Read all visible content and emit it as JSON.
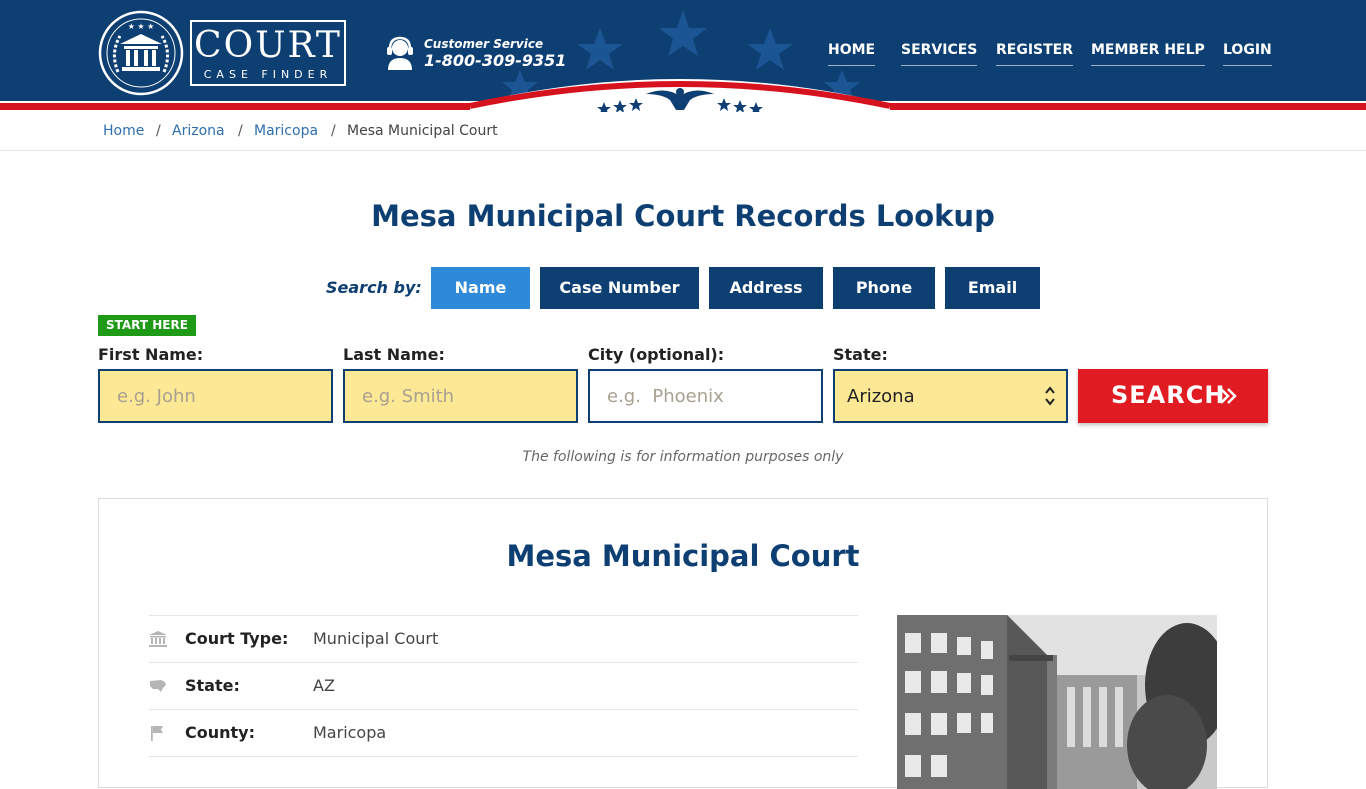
{
  "header": {
    "logo": {
      "word_main": "COURT",
      "word_sub": "CASE FINDER"
    },
    "customer_service": {
      "label": "Customer Service",
      "phone": "1-800-309-9351"
    },
    "nav": [
      {
        "label": "HOME"
      },
      {
        "label": "SERVICES"
      },
      {
        "label": "REGISTER"
      },
      {
        "label": "MEMBER HELP"
      },
      {
        "label": "LOGIN"
      }
    ],
    "colors": {
      "navy": "#0e3f73",
      "red": "#e11b22"
    }
  },
  "breadcrumb": {
    "items": [
      {
        "label": "Home"
      },
      {
        "label": "Arizona"
      },
      {
        "label": "Maricopa"
      },
      {
        "label": "Mesa Municipal Court"
      }
    ],
    "separator": "/"
  },
  "main": {
    "title": "Mesa Municipal Court Records Lookup",
    "search_by_label": "Search by:",
    "tabs": [
      {
        "label": "Name",
        "active": true
      },
      {
        "label": "Case Number",
        "active": false
      },
      {
        "label": "Address",
        "active": false
      },
      {
        "label": "Phone",
        "active": false
      },
      {
        "label": "Email",
        "active": false
      }
    ],
    "start_here": "START HERE",
    "fields": {
      "first_name": {
        "label": "First Name:",
        "placeholder": "e.g. John",
        "value": ""
      },
      "last_name": {
        "label": "Last Name:",
        "placeholder": "e.g. Smith",
        "value": ""
      },
      "city": {
        "label": "City (optional):",
        "placeholder": "e.g.  Phoenix",
        "value": ""
      },
      "state": {
        "label": "State:",
        "value": "Arizona"
      }
    },
    "search_button": "SEARCH",
    "info_note": "The following is for information purposes only"
  },
  "court": {
    "title": "Mesa Municipal Court",
    "rows": [
      {
        "key": "Court Type:",
        "value": "Municipal Court",
        "icon": "courthouse-icon"
      },
      {
        "key": "State:",
        "value": "AZ",
        "icon": "us-map-icon"
      },
      {
        "key": "County:",
        "value": "Maricopa",
        "icon": "flag-icon"
      }
    ]
  }
}
